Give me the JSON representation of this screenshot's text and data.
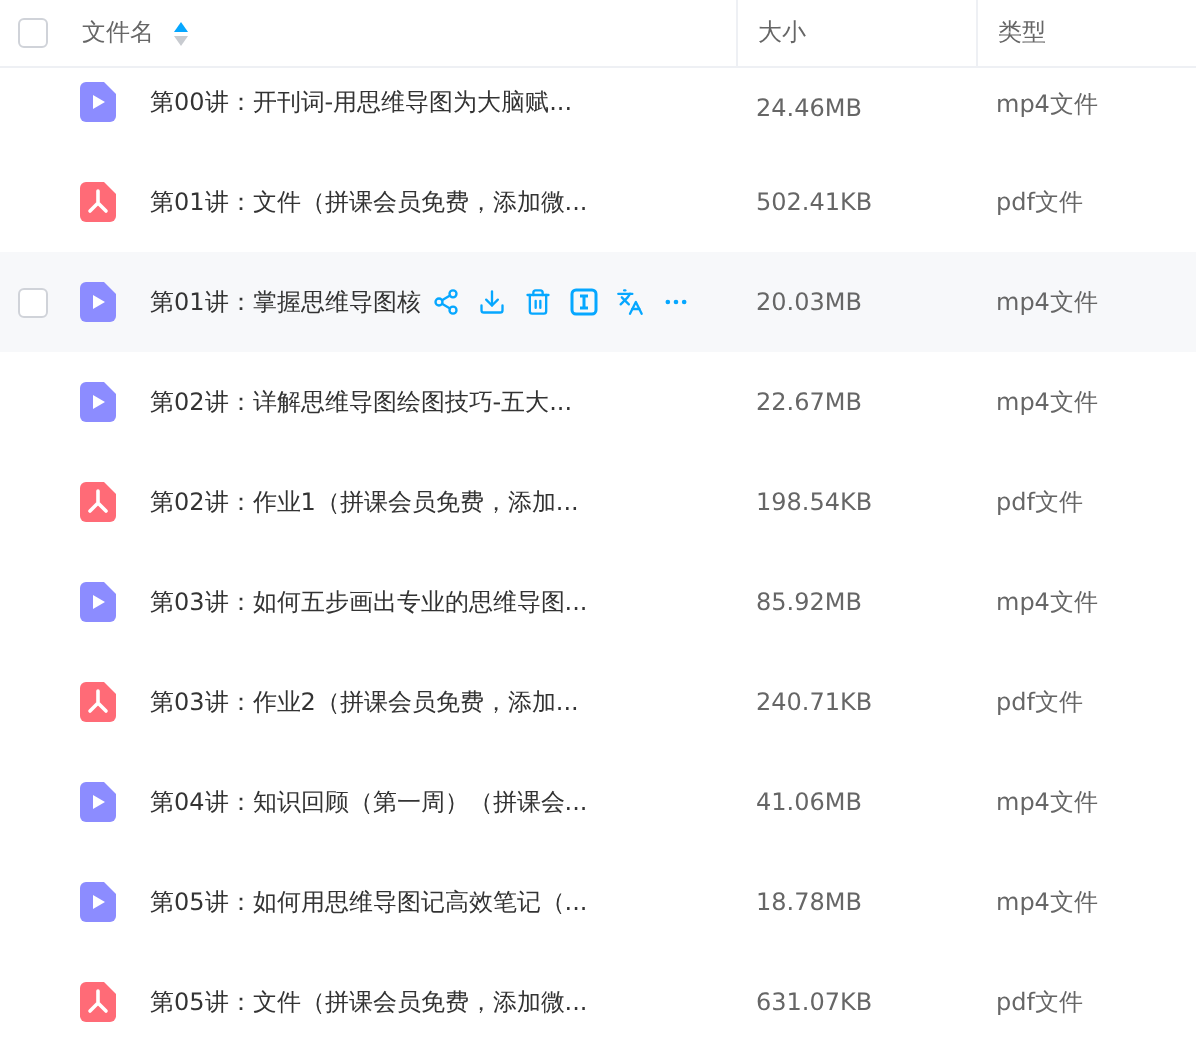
{
  "header": {
    "checked": false,
    "columns": [
      {
        "label": "文件名",
        "sorted": true
      },
      {
        "label": "大小",
        "sorted": false
      },
      {
        "label": "类型",
        "sorted": false
      }
    ]
  },
  "rows": [
    {
      "kind": "video",
      "name": "第00讲：开刊词-用思维导图为大脑赋...",
      "size": "24.46MB",
      "type": "mp4文件",
      "hovered": false
    },
    {
      "kind": "pdf",
      "name": "第01讲：文件（拼课会员免费，添加微...",
      "size": "502.41KB",
      "type": "pdf文件",
      "hovered": false
    },
    {
      "kind": "video",
      "name": "第01讲：掌握思维导图核",
      "size": "20.03MB",
      "type": "mp4文件",
      "hovered": true
    },
    {
      "kind": "video",
      "name": "第02讲：详解思维导图绘图技巧-五大...",
      "size": "22.67MB",
      "type": "mp4文件",
      "hovered": false
    },
    {
      "kind": "pdf",
      "name": "第02讲：作业1（拼课会员免费，添加...",
      "size": "198.54KB",
      "type": "pdf文件",
      "hovered": false
    },
    {
      "kind": "video",
      "name": "第03讲：如何五步画出专业的思维导图...",
      "size": "85.92MB",
      "type": "mp4文件",
      "hovered": false
    },
    {
      "kind": "pdf",
      "name": "第03讲：作业2（拼课会员免费，添加...",
      "size": "240.71KB",
      "type": "pdf文件",
      "hovered": false
    },
    {
      "kind": "video",
      "name": "第04讲：知识回顾（第一周）（拼课会...",
      "size": "41.06MB",
      "type": "mp4文件",
      "hovered": false
    },
    {
      "kind": "video",
      "name": "第05讲：如何用思维导图记高效笔记（...",
      "size": "18.78MB",
      "type": "mp4文件",
      "hovered": false
    },
    {
      "kind": "pdf",
      "name": "第05讲：文件（拼课会员免费，添加微...",
      "size": "631.07KB",
      "type": "pdf文件",
      "hovered": false
    }
  ]
}
